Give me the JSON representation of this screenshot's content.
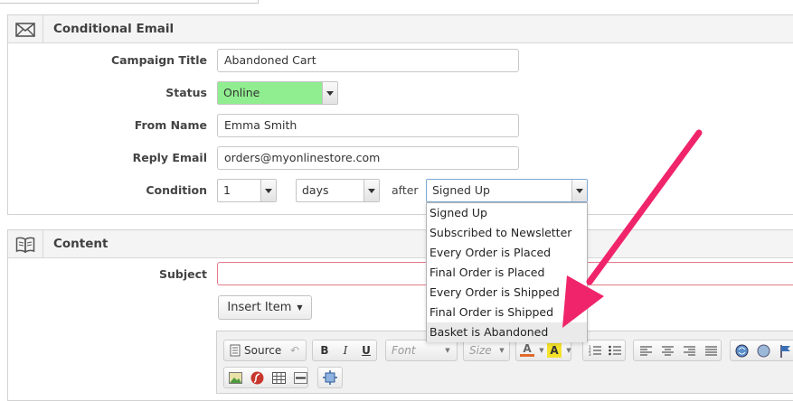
{
  "panels": {
    "conditional_email": {
      "title": "Conditional Email",
      "fields": {
        "campaign_title": {
          "label": "Campaign Title",
          "value": "Abandoned Cart"
        },
        "status": {
          "label": "Status",
          "value": "Online",
          "color": "#90ee90"
        },
        "from_name": {
          "label": "From Name",
          "value": "Emma Smith"
        },
        "reply_email": {
          "label": "Reply Email",
          "value": "orders@myonlinestore.com"
        },
        "condition": {
          "label": "Condition",
          "amount": "1",
          "unit": "days",
          "after_label": "after",
          "event": "Signed Up",
          "options": [
            "Signed Up",
            "Subscribed to Newsletter",
            "Every Order is Placed",
            "Final Order is Placed",
            "Every Order is Shipped",
            "Final Order is Shipped",
            "Basket is Abandoned"
          ],
          "highlighted_option": "Basket is Abandoned"
        }
      }
    },
    "content": {
      "title": "Content",
      "subject_label": "Subject",
      "subject_value": "",
      "insert_item_label": "Insert Item"
    }
  },
  "editor_toolbar": {
    "source_label": "Source",
    "font_placeholder": "Font",
    "size_placeholder": "Size"
  },
  "annotation": {
    "arrow_color": "#f0246a"
  }
}
